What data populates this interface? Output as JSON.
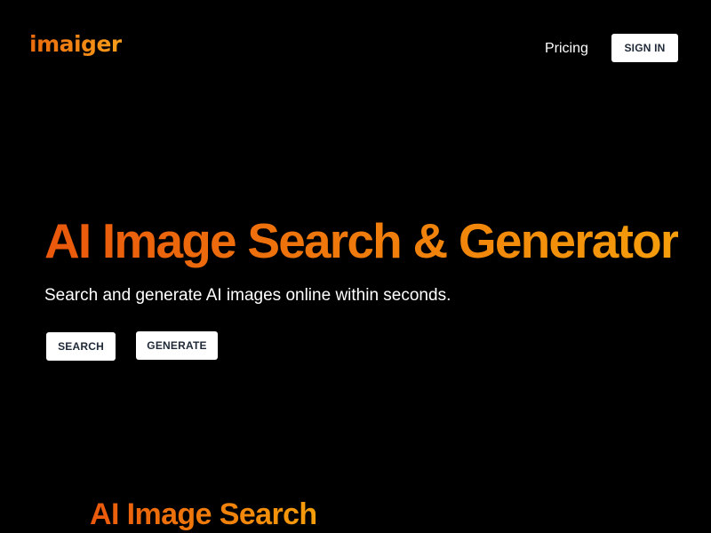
{
  "header": {
    "logo_text": "imaiger",
    "nav": {
      "pricing_label": "Pricing",
      "signin_label": "SIGN IN"
    }
  },
  "hero": {
    "title": "AI Image Search & Generator",
    "subtitle": "Search and generate AI images online within seconds.",
    "search_label": "SEARCH",
    "generate_label": "GENERATE"
  },
  "section": {
    "title": "AI Image Search"
  },
  "colors": {
    "background": "#000000",
    "accent_start": "#ea580c",
    "accent_end": "#f59e0b",
    "button_bg": "#ffffff",
    "button_text": "#1f2937"
  }
}
